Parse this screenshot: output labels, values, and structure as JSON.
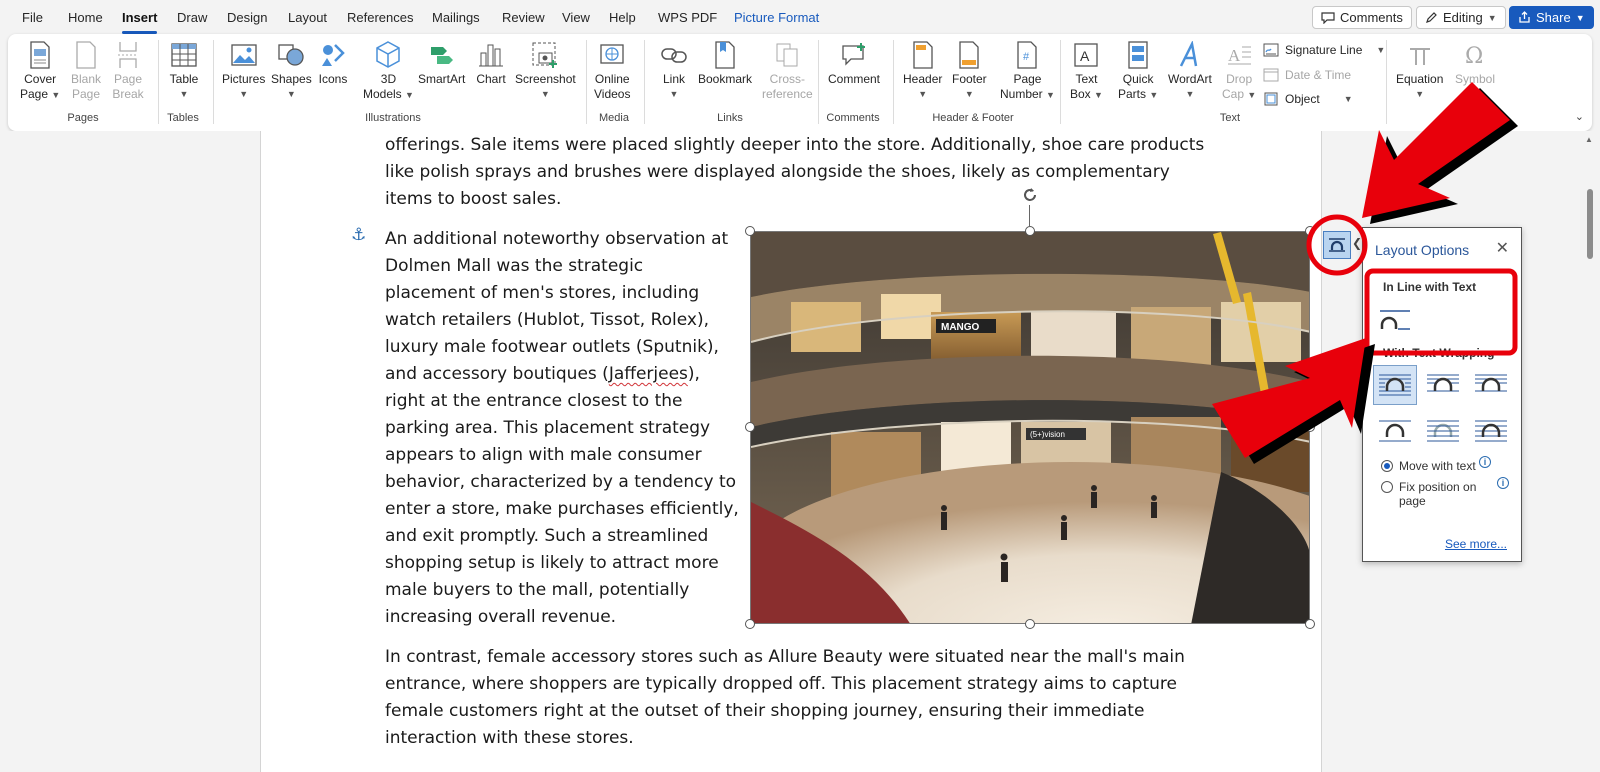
{
  "menubar": {
    "tabs": [
      "File",
      "Home",
      "Insert",
      "Draw",
      "Design",
      "Layout",
      "References",
      "Mailings",
      "Review",
      "View",
      "Help",
      "WPS PDF",
      "Picture Format"
    ],
    "active_tab": "Insert",
    "comments_label": "Comments",
    "editing_label": "Editing",
    "share_label": "Share"
  },
  "ribbon": {
    "pages": {
      "cover_page": [
        "Cover",
        "Page"
      ],
      "blank_page": [
        "Blank",
        "Page"
      ],
      "page_break": [
        "Page",
        "Break"
      ],
      "group": "Pages"
    },
    "tables": {
      "table": "Table",
      "group": "Tables"
    },
    "illustrations": {
      "pictures": "Pictures",
      "shapes": "Shapes",
      "icons": "Icons",
      "models": [
        "3D",
        "Models"
      ],
      "smartart": "SmartArt",
      "chart": "Chart",
      "screenshot": "Screenshot",
      "group": "Illustrations"
    },
    "media": {
      "online_videos": [
        "Online",
        "Videos"
      ],
      "group": "Media"
    },
    "links": {
      "link": "Link",
      "bookmark": "Bookmark",
      "cross_reference": [
        "Cross-",
        "reference"
      ],
      "group": "Links"
    },
    "comments": {
      "comment": "Comment",
      "group": "Comments"
    },
    "header_footer": {
      "header": "Header",
      "footer": "Footer",
      "page_number": [
        "Page",
        "Number"
      ],
      "group": "Header & Footer"
    },
    "text": {
      "text_box": [
        "Text",
        "Box"
      ],
      "quick_parts": [
        "Quick",
        "Parts"
      ],
      "wordart": "WordArt",
      "drop_cap": [
        "Drop",
        "Cap"
      ],
      "signature_line": "Signature Line",
      "date_time": "Date & Time",
      "object": "Object",
      "group": "Text"
    },
    "symbols": {
      "equation": "Equation",
      "symbol": "Symbol"
    }
  },
  "document": {
    "para1": [
      "offerings. Sale items were placed slightly deeper into the store. Additionally, shoe care products",
      "like polish sprays and brushes were displayed alongside the shoes, likely as complementary",
      "items to boost sales."
    ],
    "para2": [
      "An additional noteworthy observation at",
      "Dolmen Mall was the strategic",
      "placement of men's stores, including",
      "watch retailers (Hublot, Tissot, Rolex),",
      "luxury male footwear outlets (Sputnik),",
      "and accessory boutiques (",
      "Jafferjees",
      "),",
      "right at the entrance closest to the",
      "parking area. This placement strategy",
      "appears to align with male consumer",
      "behavior, characterized by a tendency to",
      "enter a store, make purchases efficiently,",
      "and exit promptly. Such a streamlined",
      "shopping setup is likely to attract more",
      "male buyers to the mall, potentially",
      "increasing overall revenue."
    ],
    "para3": [
      "In contrast, female accessory stores such as Allure Beauty were situated near the mall's main",
      "entrance, where shoppers are typically dropped off. This placement strategy aims to capture",
      "female customers right at the outset of their shopping journey, ensuring their immediate",
      "interaction with these stores."
    ],
    "photo_sign": "MANGO",
    "photo_sign2": "(5+)vision"
  },
  "layout_options": {
    "title": "Layout Options",
    "inline_heading": "In Line with Text",
    "wrap_heading": "With Text Wrapping",
    "move_with_text": "Move with text",
    "fix_position": "Fix position on page",
    "see_more": "See more...",
    "selected_option": "Move with text"
  },
  "colors": {
    "accent": "#185abd",
    "annotation": "#e8000b"
  }
}
